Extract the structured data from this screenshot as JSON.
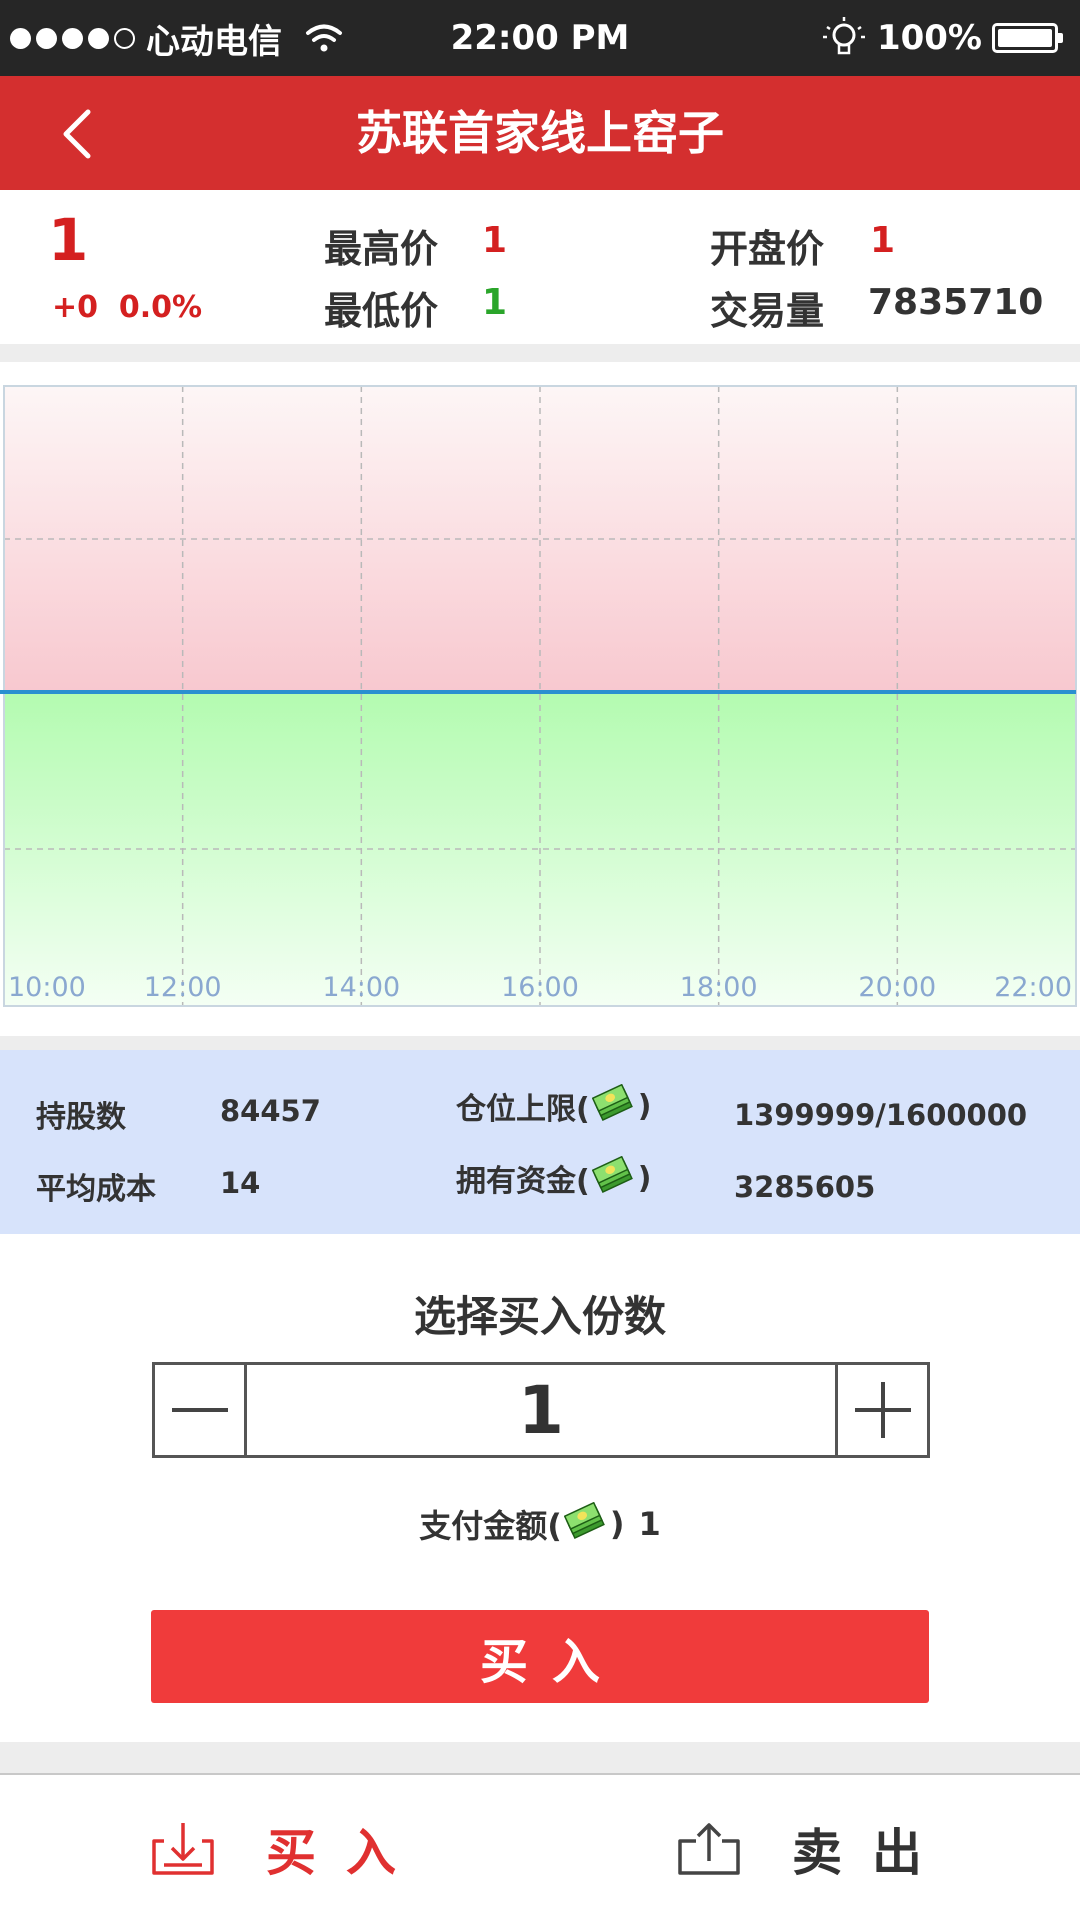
{
  "status_bar": {
    "carrier": "心动电信",
    "time": "22:00 PM",
    "battery": "100%",
    "battery_level": 1.0
  },
  "nav": {
    "title": "苏联首家线上窑子",
    "back_icon": "chevron-left-icon"
  },
  "quote": {
    "price": "1",
    "change": "+0  0.0%",
    "high_label": "最高价",
    "high_value": "1",
    "low_label": "最低价",
    "low_value": "1",
    "open_label": "开盘价",
    "open_value": "1",
    "volume_label": "交易量",
    "volume_value": "7835710"
  },
  "chart_data": {
    "type": "line",
    "x": [
      "10:00",
      "12:00",
      "14:00",
      "16:00",
      "18:00",
      "20:00",
      "22:00"
    ],
    "series": [
      {
        "values": [
          1,
          1,
          1,
          1,
          1,
          1,
          1
        ]
      }
    ],
    "tick_labels": [
      "10:00",
      "12:00",
      "14:00",
      "16:00",
      "18:00",
      "20:00",
      "22:00"
    ],
    "grid": true,
    "colors": {
      "line": "#2a8fd0",
      "above": "#f8c8cf",
      "below": "#b3fbb0"
    }
  },
  "holdings": {
    "shares_label": "持股数",
    "shares_value": "84457",
    "avg_cost_label": "平均成本",
    "avg_cost_value": "14",
    "position_limit_label_pre": "仓位上限(",
    "position_limit_label_post": ")",
    "position_limit_value": "1399999/1600000",
    "funds_label_pre": "拥有资金(",
    "funds_label_post": ")",
    "funds_value": "3285605",
    "currency_icon": "money-stack-icon"
  },
  "buy_panel": {
    "title": "选择买入份数",
    "quantity": "1",
    "minus_icon": "minus-icon",
    "plus_icon": "plus-icon",
    "pay_label_pre": "支付金额(",
    "pay_label_post": ")",
    "pay_value": "1",
    "buy_button": "买入"
  },
  "tabs": [
    {
      "label": "买入",
      "icon": "download-tray-icon",
      "active": true
    },
    {
      "label": "卖出",
      "icon": "upload-tray-icon",
      "active": false
    }
  ],
  "colors": {
    "brand_red": "#d42f2f",
    "button_red": "#f03b3b",
    "info_bg": "#d7e3fb"
  }
}
